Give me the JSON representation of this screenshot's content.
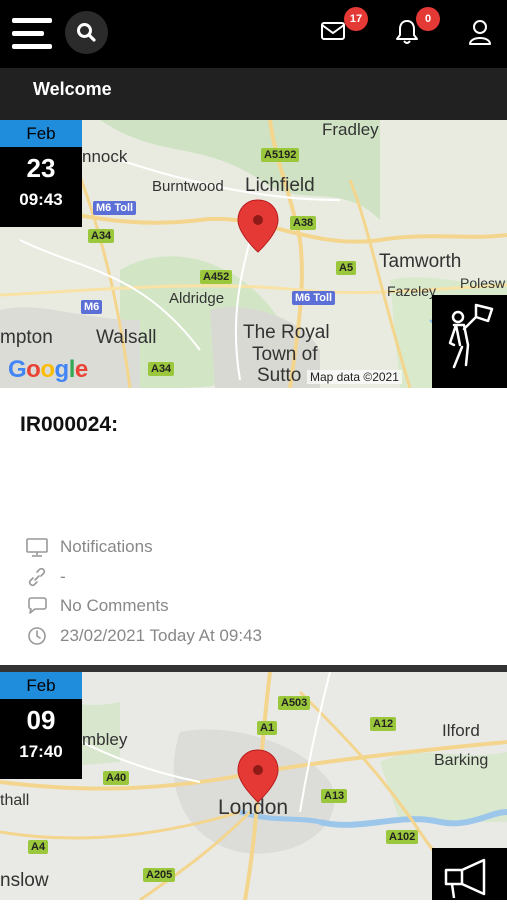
{
  "header": {
    "messages_count": "17",
    "notifications_count": "0",
    "subtitle": "Welcome"
  },
  "cards": [
    {
      "month": "Feb",
      "day": "23",
      "time": "09:43",
      "map": {
        "places": [
          "Fradley",
          "nnock",
          "Burntwood",
          "Lichfield",
          "Tamworth",
          "Polesw",
          "Fazeley",
          "Aldridge",
          "mpton",
          "Walsall",
          "The Royal",
          "Town of",
          "Sutto"
        ],
        "roads": [
          "A5192",
          "M6 Toll",
          "A38",
          "A34",
          "A5",
          "A452",
          "M6 Toll",
          "M6",
          "A34"
        ],
        "google_label": "Google",
        "attribution": "Map data ©2021"
      },
      "title": "IR000024:",
      "meta": {
        "category": "Notifications",
        "link": "-",
        "comments": "No Comments",
        "datetime": "23/02/2021 Today At 09:43"
      }
    },
    {
      "month": "Feb",
      "day": "09",
      "time": "17:40",
      "map": {
        "places": [
          "mbley",
          "Ilford",
          "Barking",
          "thall",
          "London",
          "nslow"
        ],
        "roads": [
          "A503",
          "A1",
          "A12",
          "A40",
          "A13",
          "A4",
          "A102",
          "A205"
        ]
      }
    }
  ]
}
